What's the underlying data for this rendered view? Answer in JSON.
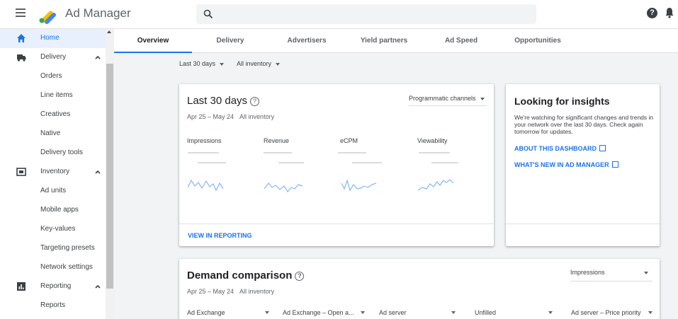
{
  "app": {
    "title": "Ad Manager"
  },
  "sidebar": {
    "items": [
      {
        "label": "Home",
        "icon": "home-icon"
      },
      {
        "label": "Delivery",
        "icon": "truck-icon"
      },
      {
        "label": "Orders"
      },
      {
        "label": "Line items"
      },
      {
        "label": "Creatives"
      },
      {
        "label": "Native"
      },
      {
        "label": "Delivery tools"
      },
      {
        "label": "Inventory",
        "icon": "inventory-icon"
      },
      {
        "label": "Ad units"
      },
      {
        "label": "Mobile apps"
      },
      {
        "label": "Key-values"
      },
      {
        "label": "Targeting presets"
      },
      {
        "label": "Network settings"
      },
      {
        "label": "Reporting",
        "icon": "reporting-icon"
      },
      {
        "label": "Reports"
      }
    ]
  },
  "tabs": [
    "Overview",
    "Delivery",
    "Advertisers",
    "Yield partners",
    "Ad Speed",
    "Opportunities"
  ],
  "filters": {
    "date": "Last 30 days",
    "inventory": "All inventory"
  },
  "summary": {
    "title": "Last 30 days",
    "help": "?",
    "date_range": "Apr 25 – May 24",
    "inventory": "All inventory",
    "channel": "Programmatic channels",
    "metrics": [
      "Impressions",
      "Revenue",
      "eCPM",
      "Viewability"
    ],
    "link": "VIEW IN REPORTING"
  },
  "insights": {
    "title": "Looking for insights",
    "text": "We're watching for significant changes and trends in your network over the last 30 days. Check again tomorrow for updates.",
    "link_dashboard": "ABOUT THIS DASHBOARD",
    "link_whats_new": "WHAT'S NEW IN AD MANAGER"
  },
  "demand": {
    "title": "Demand comparison",
    "help": "?",
    "date_range": "Apr 25 – May 24",
    "inventory": "All inventory",
    "metric": "Impressions",
    "columns": [
      "Ad Exchange",
      "Ad Exchange – Open a...",
      "Ad server",
      "Unfilled",
      "Ad server – Price priority"
    ]
  },
  "colors": {
    "accent": "#1a73e8",
    "spark": "#8ab4f8"
  }
}
